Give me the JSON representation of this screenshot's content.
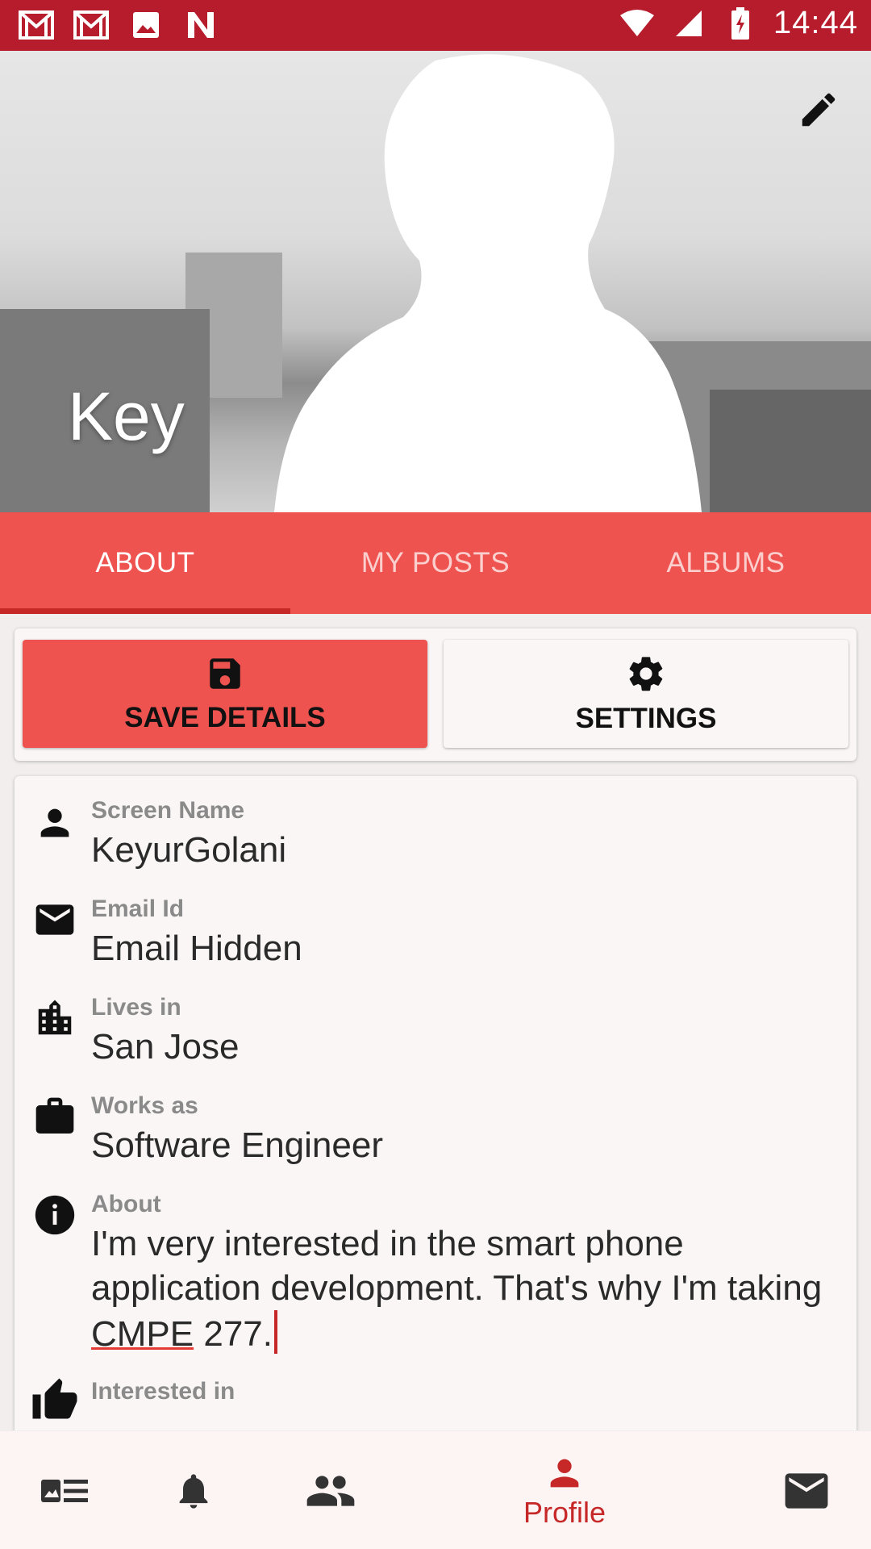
{
  "status_bar": {
    "time": "14:44",
    "left_icons": [
      "gmail-icon",
      "gmail-icon",
      "image-icon",
      "n-app-icon"
    ],
    "right_icons": [
      "wifi-icon",
      "signal-icon",
      "battery-charging-icon"
    ]
  },
  "header": {
    "name": "Key",
    "edit_icon": "pencil-icon"
  },
  "tabs": [
    {
      "label": "ABOUT",
      "active": true
    },
    {
      "label": "MY POSTS",
      "active": false
    },
    {
      "label": "ALBUMS",
      "active": false
    }
  ],
  "actions": {
    "save_label": "SAVE DETAILS",
    "settings_label": "SETTINGS"
  },
  "fields": {
    "screen_name": {
      "label": "Screen Name",
      "value": "KeyurGolani"
    },
    "email": {
      "label": "Email Id",
      "value": "Email Hidden"
    },
    "lives_in": {
      "label": "Lives in",
      "value": "San Jose"
    },
    "works_as": {
      "label": "Works as",
      "value": "Software Engineer"
    },
    "about": {
      "label": "About",
      "value_before": "I'm very interested in the smart phone application development. That's why I'm taking ",
      "value_underlined": "CMPE",
      "value_after": " 277."
    },
    "interested_in": {
      "label": "Interested in"
    }
  },
  "bottom_nav": {
    "profile_label": "Profile"
  },
  "colors": {
    "status_bar": "#b71c2c",
    "accent": "#ef5350",
    "accent_dark": "#c62828"
  }
}
